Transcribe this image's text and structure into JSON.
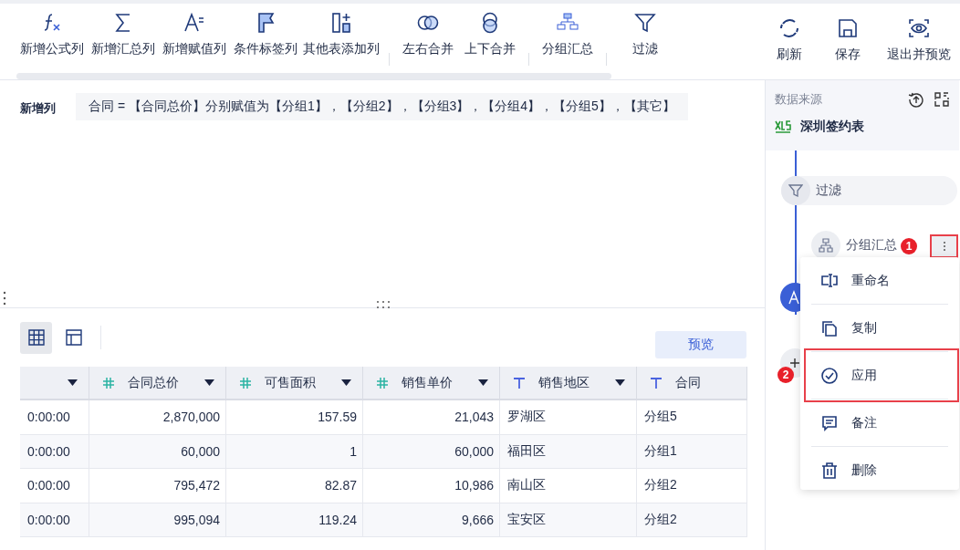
{
  "toolbar": {
    "groups": [
      [
        {
          "label": "新增公式列",
          "kind": "formula"
        },
        {
          "label": "新增汇总列",
          "kind": "sum"
        },
        {
          "label": "新增赋值列",
          "kind": "assign"
        },
        {
          "label": "条件标签列",
          "kind": "flag"
        },
        {
          "label": "其他表添加列",
          "kind": "add-column"
        }
      ],
      [
        {
          "label": "左右合并",
          "kind": "merge-h"
        },
        {
          "label": "上下合并",
          "kind": "merge-v"
        }
      ],
      [
        {
          "label": "分组汇总",
          "kind": "group"
        }
      ],
      [
        {
          "label": "过滤",
          "kind": "filter"
        }
      ]
    ],
    "actions": [
      {
        "label": "刷新",
        "kind": "refresh"
      },
      {
        "label": "保存",
        "kind": "save"
      },
      {
        "label": "退出并预览",
        "kind": "preview"
      }
    ]
  },
  "formula": {
    "label": "新增列",
    "text": "合同 = 【合同总价】分别赋值为【分组1】，【分组2】，【分组3】，【分组4】，【分组5】，【其它】"
  },
  "view_toggle": [
    {
      "kind": "grid",
      "selected": true
    },
    {
      "kind": "layout",
      "selected": false
    }
  ],
  "preview_button": "预览",
  "table": {
    "columns": [
      {
        "kind": "none",
        "dropdown": true
      },
      {
        "kind": "number",
        "label": "合同总价",
        "dropdown": true
      },
      {
        "kind": "number",
        "label": "可售面积",
        "dropdown": true
      },
      {
        "kind": "number",
        "label": "销售单价",
        "dropdown": true
      },
      {
        "kind": "text",
        "label": "销售地区",
        "dropdown": true
      },
      {
        "kind": "text",
        "label": "合同",
        "dropdown": false
      }
    ],
    "rows": [
      [
        "0:00:00",
        "2,870,000",
        "157.59",
        "21,043",
        "罗湖区",
        "分组5"
      ],
      [
        "0:00:00",
        "60,000",
        "1",
        "60,000",
        "福田区",
        "分组1"
      ],
      [
        "0:00:00",
        "795,472",
        "82.87",
        "10,986",
        "南山区",
        "分组2"
      ],
      [
        "0:00:00",
        "995,094",
        "119.24",
        "9,666",
        "宝安区",
        "分组2"
      ]
    ]
  },
  "source": {
    "title": "数据来源",
    "table_name": "深圳签约表"
  },
  "flow": [
    {
      "kind": "filter",
      "label": "过滤"
    },
    {
      "kind": "group",
      "label": "分组汇总",
      "badge": "1",
      "menu_annotated": true
    },
    {
      "kind": "assign"
    },
    {
      "kind": "add",
      "badge": "2"
    }
  ],
  "menu": [
    {
      "label": "重命名",
      "kind": "rename",
      "annotated": false
    },
    {
      "label": "复制",
      "kind": "copy",
      "annotated": false
    },
    {
      "label": "应用",
      "kind": "check",
      "annotated": true
    },
    {
      "label": "备注",
      "kind": "note",
      "annotated": false
    },
    {
      "label": "删除",
      "kind": "trash",
      "annotated": false
    }
  ]
}
